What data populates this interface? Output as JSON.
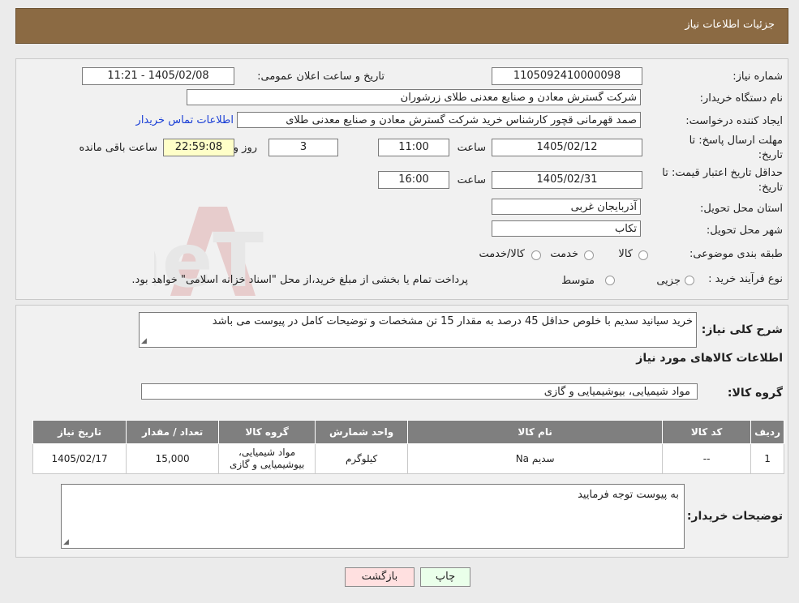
{
  "header": {
    "title": "جزئیات اطلاعات نیاز"
  },
  "form": {
    "need_number_label": "شماره نیاز:",
    "need_number": "1105092410000098",
    "announce_label": "تاریخ و ساعت اعلان عمومی:",
    "announce_value": "1405/02/08 - 11:21",
    "buyer_org_label": "نام دستگاه خریدار:",
    "buyer_org": "شرکت گسترش معادن و صنایع معدنی طلای زرشوران",
    "creator_label": "ایجاد کننده درخواست:",
    "creator": "صمد قهرمانی قچور کارشناس خرید شرکت گسترش معادن و صنایع معدنی طلای",
    "contact_link": "اطلاعات تماس خریدار",
    "deadline_label_1": "مهلت ارسال پاسخ: تا",
    "deadline_label_2": "تاریخ:",
    "deadline_date": "1405/02/12",
    "time_label": "ساعت",
    "deadline_time": "11:00",
    "days": "3",
    "days_label": "روز و",
    "remaining_time": "22:59:08",
    "remaining_label": "ساعت باقی مانده",
    "price_validity_label_1": "حداقل تاریخ اعتبار قیمت: تا",
    "price_validity_label_2": "تاریخ:",
    "price_validity_date": "1405/02/31",
    "price_validity_time": "16:00",
    "province_label": "استان محل تحویل:",
    "province": "آذربایجان غربی",
    "city_label": "شهر محل تحویل:",
    "city": "تکاب",
    "category_label": "طبقه بندی موضوعی:",
    "category_options": [
      "کالا",
      "خدمت",
      "کالا/خدمت"
    ],
    "process_label": "نوع فرآیند خرید :",
    "process_options": [
      "جزیی",
      "متوسط"
    ],
    "process_note": "پرداخت تمام یا بخشی از مبلغ خرید،از محل \"اسناد خزانه اسلامی\" خواهد بود."
  },
  "details": {
    "desc_label": "شرح کلی نیاز:",
    "desc": "خرید سیانید سدیم با خلوص حداقل 45 درصد به مقدار 15 تن مشخصات و توضیحات کامل در پیوست می باشد",
    "goods_info_title": "اطلاعات کالاهای مورد نیاز",
    "group_label": "گروه کالا:",
    "group_value": "مواد شیمیایی، بیوشیمیایی و  گازی",
    "table": {
      "headers": [
        "ردیف",
        "کد کالا",
        "نام کالا",
        "واحد شمارش",
        "گروه کالا",
        "تعداد / مقدار",
        "تاریخ نیاز"
      ],
      "row": [
        "1",
        "--",
        "سدیم Na",
        "کیلوگرم",
        "مواد شیمیایی، بیوشیمیایی و گازی",
        "15,000",
        "1405/02/17"
      ]
    },
    "buyer_notes_label": "توضیحات خریدار:",
    "buyer_notes": "به پیوست توجه فرمایید"
  },
  "buttons": {
    "print": "چاپ",
    "back": "بازگشت"
  },
  "watermark_text": "AriaTender.neT"
}
